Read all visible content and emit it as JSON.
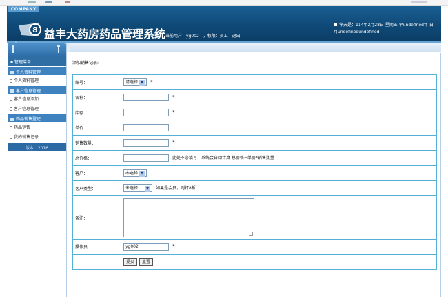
{
  "header": {
    "company_badge": "COMPANY",
    "title": "益丰大药房药品管理系统",
    "current_user_label": "当前用户：yg002",
    "role_label": "，权限：员工",
    "logout": "退出",
    "date_line1": "今天是：114年2月28日 星期五 早undefined年 日",
    "date_line2": "月undefinedundefined"
  },
  "sidebar": {
    "menu_title": "管理菜单",
    "sections": [
      {
        "label": "个人资料管理",
        "items": [
          "个人资料管理"
        ]
      },
      {
        "label": "客户信息管理",
        "items": [
          "客户信息添加",
          "客户信息管理"
        ]
      },
      {
        "label": "药品销售登记",
        "items": [
          "药品销售",
          "我的销售记录"
        ]
      }
    ],
    "version": "版本：2016"
  },
  "main": {
    "page_title": "添加销售记录:",
    "fields": {
      "code": {
        "label": "编号：",
        "select_value": "请选择",
        "required": "*"
      },
      "name": {
        "label": "名称：",
        "value": "",
        "required": "*"
      },
      "stock": {
        "label": "库存：",
        "value": "",
        "required": "*"
      },
      "price": {
        "label": "单价：",
        "value": ""
      },
      "quantity": {
        "label": "销售数量：",
        "value": "",
        "required": "*"
      },
      "total": {
        "label": "总价格：",
        "value": "",
        "note": "此处不必填写，系统会自动计算 总价格=单价*销售数量"
      },
      "customer": {
        "label": "客户：",
        "select_value": "未选择"
      },
      "customer_type": {
        "label": "客户类型：",
        "select_value": "未选择",
        "note": "如果是会员，则打8折"
      },
      "remark": {
        "label": "备注：",
        "value": ""
      },
      "operator": {
        "label": "操作员：",
        "value": "yg002",
        "required": "*"
      }
    },
    "buttons": {
      "submit": "提交",
      "reset": "重置"
    }
  }
}
